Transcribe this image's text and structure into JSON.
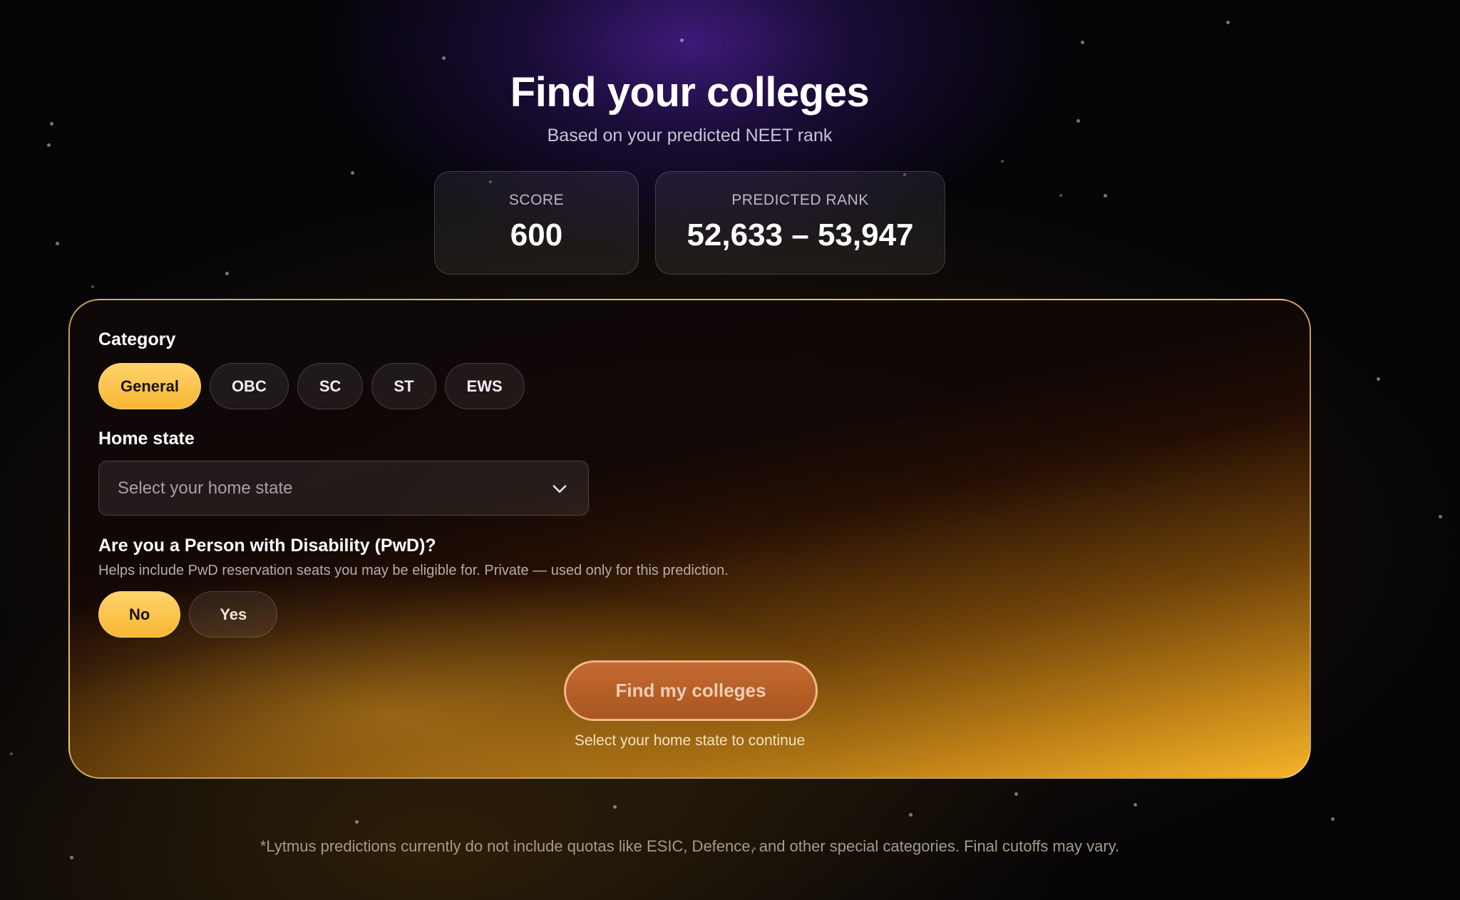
{
  "header": {
    "title": "Find your colleges",
    "subtitle": "Based on your predicted NEET rank"
  },
  "stats": {
    "score_label": "SCORE",
    "score_value": "600",
    "rank_label": "PREDICTED RANK",
    "rank_value": "52,633 – 53,947"
  },
  "form": {
    "category": {
      "label": "Category",
      "options": [
        "General",
        "OBC",
        "SC",
        "ST",
        "EWS"
      ],
      "selected": "General"
    },
    "home_state": {
      "label": "Home state",
      "placeholder": "Select your home state"
    },
    "pwd": {
      "label": "Are you a Person with Disability (PwD)?",
      "helper": "Helps include PwD reservation seats you may be eligible for. Private — used only for this prediction.",
      "options": [
        "No",
        "Yes"
      ],
      "selected": "No"
    },
    "submit": {
      "label": "Find my colleges",
      "hint": "Select your home state to continue"
    }
  },
  "footnote": "*Lytmus predictions currently do not include quotas like ESIC, Defence, and other special categories. Final cutoffs may vary.",
  "colors": {
    "accent": "#f7b733",
    "cta": "#b35e28",
    "background": "#050407"
  },
  "icons": {
    "select_chevron": "chevron-down-icon"
  }
}
